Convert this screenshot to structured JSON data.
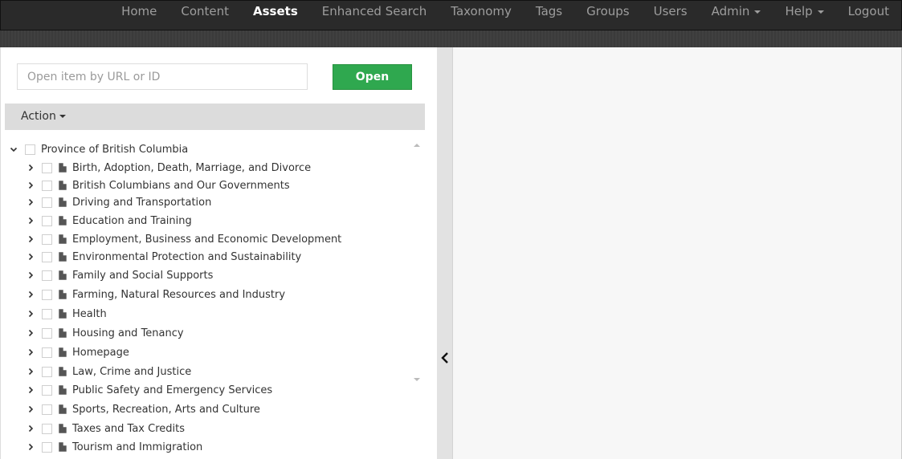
{
  "nav": {
    "items": [
      {
        "label": "Home",
        "active": false,
        "dropdown": false
      },
      {
        "label": "Content",
        "active": false,
        "dropdown": false
      },
      {
        "label": "Assets",
        "active": true,
        "dropdown": false
      },
      {
        "label": "Enhanced Search",
        "active": false,
        "dropdown": false
      },
      {
        "label": "Taxonomy",
        "active": false,
        "dropdown": false
      },
      {
        "label": "Tags",
        "active": false,
        "dropdown": false
      },
      {
        "label": "Groups",
        "active": false,
        "dropdown": false
      },
      {
        "label": "Users",
        "active": false,
        "dropdown": false
      },
      {
        "label": "Admin",
        "active": false,
        "dropdown": true
      },
      {
        "label": "Help",
        "active": false,
        "dropdown": true
      },
      {
        "label": "Logout",
        "active": false,
        "dropdown": false
      }
    ]
  },
  "open_item": {
    "placeholder": "Open item by URL or ID",
    "button_label": "Open",
    "button_color": "#2fa84f"
  },
  "action": {
    "label": "Action"
  },
  "tree": {
    "root": {
      "label": "Province of British Columbia",
      "expanded": true
    },
    "children": [
      {
        "label": "Birth, Adoption, Death, Marriage, and Divorce"
      },
      {
        "label": "British Columbians and Our Governments"
      },
      {
        "label": "Driving and Transportation"
      },
      {
        "label": "Education and Training"
      },
      {
        "label": "Employment, Business and Economic Development"
      },
      {
        "label": "Environmental Protection and Sustainability"
      },
      {
        "label": "Family and Social Supports"
      },
      {
        "label": "Farming, Natural Resources and Industry"
      },
      {
        "label": "Health"
      },
      {
        "label": "Housing and Tenancy"
      },
      {
        "label": "Homepage"
      },
      {
        "label": "Law, Crime and Justice"
      },
      {
        "label": "Public Safety and Emergency Services"
      },
      {
        "label": "Sports, Recreation, Arts and Culture"
      },
      {
        "label": "Taxes and Tax Credits"
      },
      {
        "label": "Tourism and Immigration"
      }
    ]
  },
  "icons": {
    "expand": "chevron-right-icon",
    "collapse": "chevron-down-icon",
    "page": "document-icon",
    "pane_toggle": "chevron-left-icon"
  }
}
